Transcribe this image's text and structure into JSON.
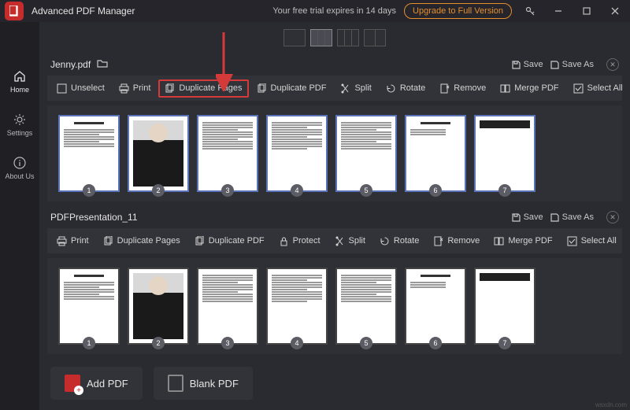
{
  "titlebar": {
    "app_name": "Advanced PDF Manager",
    "trial_text": "Your free trial expires in 14 days",
    "upgrade_label": "Upgrade to Full Version"
  },
  "sidebar": {
    "home": "Home",
    "settings": "Settings",
    "about": "About Us"
  },
  "doc1": {
    "name": "Jenny.pdf",
    "save": "Save",
    "saveas": "Save As",
    "toolbar": {
      "unselect": "Unselect",
      "print": "Print",
      "duppages": "Duplicate Pages",
      "duppdf": "Duplicate PDF",
      "split": "Split",
      "rotate": "Rotate",
      "remove": "Remove",
      "merge": "Merge PDF",
      "selectall": "Select All"
    },
    "pages": [
      "1",
      "2",
      "3",
      "4",
      "5",
      "6",
      "7"
    ]
  },
  "doc2": {
    "name": "PDFPresentation_11",
    "save": "Save",
    "saveas": "Save As",
    "toolbar": {
      "print": "Print",
      "duppages": "Duplicate Pages",
      "duppdf": "Duplicate PDF",
      "protect": "Protect",
      "split": "Split",
      "rotate": "Rotate",
      "remove": "Remove",
      "merge": "Merge PDF",
      "selectall": "Select All"
    },
    "pages": [
      "1",
      "2",
      "3",
      "4",
      "5",
      "6",
      "7"
    ]
  },
  "bottom": {
    "add": "Add PDF",
    "blank": "Blank PDF"
  },
  "watermark": "wsxdn.com"
}
